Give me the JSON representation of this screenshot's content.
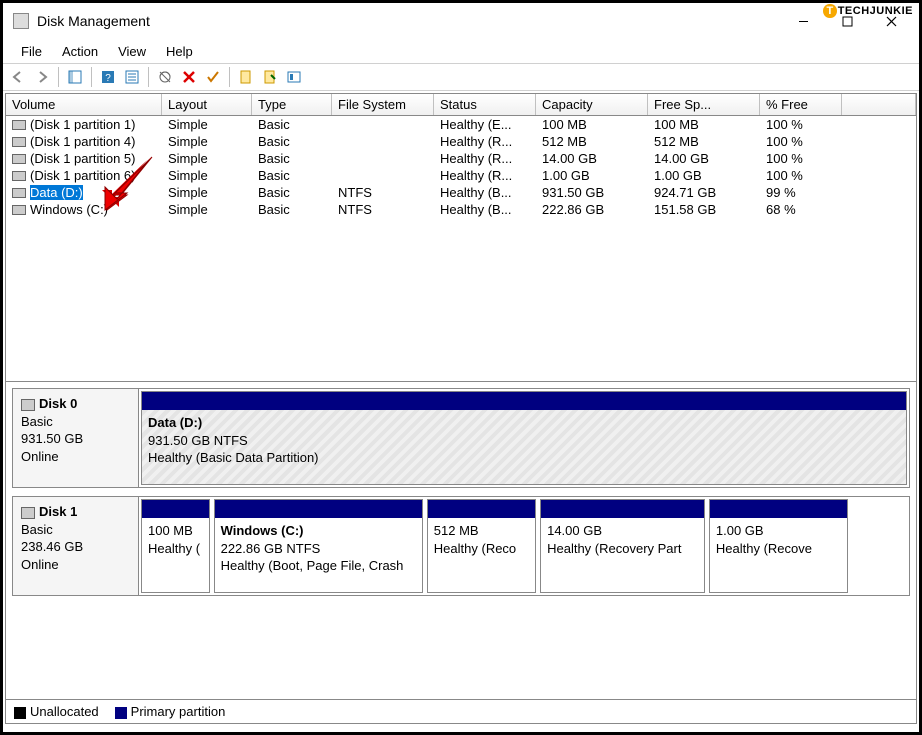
{
  "watermark": "TECHJUNKIE",
  "title": "Disk Management",
  "menu": [
    "File",
    "Action",
    "View",
    "Help"
  ],
  "columns": [
    "Volume",
    "Layout",
    "Type",
    "File System",
    "Status",
    "Capacity",
    "Free Sp...",
    "% Free"
  ],
  "volumes": [
    {
      "name": "(Disk 1 partition 1)",
      "layout": "Simple",
      "type": "Basic",
      "fs": "",
      "status": "Healthy (E...",
      "capacity": "100 MB",
      "free": "100 MB",
      "pct": "100 %",
      "selected": false
    },
    {
      "name": "(Disk 1 partition 4)",
      "layout": "Simple",
      "type": "Basic",
      "fs": "",
      "status": "Healthy (R...",
      "capacity": "512 MB",
      "free": "512 MB",
      "pct": "100 %",
      "selected": false
    },
    {
      "name": "(Disk 1 partition 5)",
      "layout": "Simple",
      "type": "Basic",
      "fs": "",
      "status": "Healthy (R...",
      "capacity": "14.00 GB",
      "free": "14.00 GB",
      "pct": "100 %",
      "selected": false
    },
    {
      "name": "(Disk 1 partition 6)",
      "layout": "Simple",
      "type": "Basic",
      "fs": "",
      "status": "Healthy (R...",
      "capacity": "1.00 GB",
      "free": "1.00 GB",
      "pct": "100 %",
      "selected": false
    },
    {
      "name": "Data (D:)",
      "layout": "Simple",
      "type": "Basic",
      "fs": "NTFS",
      "status": "Healthy (B...",
      "capacity": "931.50 GB",
      "free": "924.71 GB",
      "pct": "99 %",
      "selected": true
    },
    {
      "name": "Windows (C:)",
      "layout": "Simple",
      "type": "Basic",
      "fs": "NTFS",
      "status": "Healthy (B...",
      "capacity": "222.86 GB",
      "free": "151.58 GB",
      "pct": "68 %",
      "selected": false
    }
  ],
  "disks": [
    {
      "name": "Disk 0",
      "type": "Basic",
      "size": "931.50 GB",
      "status": "Online",
      "parts": [
        {
          "label": "Data  (D:)",
          "line2": "931.50 GB NTFS",
          "line3": "Healthy (Basic Data Partition)",
          "flex": 1,
          "hatched": true,
          "bold": true
        }
      ]
    },
    {
      "name": "Disk 1",
      "type": "Basic",
      "size": "238.46 GB",
      "status": "Online",
      "parts": [
        {
          "label": "",
          "line2": "100 MB",
          "line3": "Healthy (",
          "flex": 0.09,
          "hatched": false,
          "bold": false
        },
        {
          "label": "Windows  (C:)",
          "line2": "222.86 GB NTFS",
          "line3": "Healthy (Boot, Page File, Crash",
          "flex": 0.28,
          "hatched": false,
          "bold": true
        },
        {
          "label": "",
          "line2": "512 MB",
          "line3": "Healthy (Reco",
          "flex": 0.145,
          "hatched": false,
          "bold": false
        },
        {
          "label": "",
          "line2": "14.00 GB",
          "line3": "Healthy (Recovery Part",
          "flex": 0.22,
          "hatched": false,
          "bold": false
        },
        {
          "label": "",
          "line2": "1.00 GB",
          "line3": "Healthy (Recove",
          "flex": 0.185,
          "hatched": false,
          "bold": false
        }
      ]
    }
  ],
  "legend": {
    "unallocated": "Unallocated",
    "primary": "Primary partition"
  }
}
